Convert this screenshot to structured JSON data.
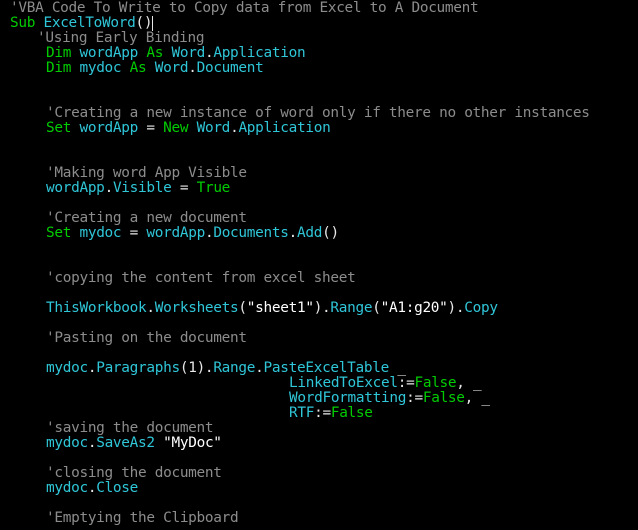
{
  "lines": [
    {
      "indent": 0,
      "tokens": [
        {
          "t": "c",
          "v": "'VBA Code To Write to Copy data from Excel to A Document"
        }
      ]
    },
    {
      "indent": 0,
      "tokens": [
        {
          "t": "k",
          "v": "Sub "
        },
        {
          "t": "i",
          "v": "ExcelToWord"
        },
        {
          "t": "o",
          "v": "()"
        },
        {
          "t": "cursor",
          "v": ""
        }
      ]
    },
    {
      "indent": 27,
      "tokens": [
        {
          "t": "c",
          "v": "'Using Early Binding"
        }
      ]
    },
    {
      "indent": 36,
      "tokens": [
        {
          "t": "k",
          "v": "Dim "
        },
        {
          "t": "i",
          "v": "wordApp "
        },
        {
          "t": "k",
          "v": "As "
        },
        {
          "t": "i",
          "v": "Word"
        },
        {
          "t": "o",
          "v": "."
        },
        {
          "t": "i",
          "v": "Application"
        }
      ]
    },
    {
      "indent": 36,
      "tokens": [
        {
          "t": "k",
          "v": "Dim "
        },
        {
          "t": "i",
          "v": "mydoc "
        },
        {
          "t": "k",
          "v": "As "
        },
        {
          "t": "i",
          "v": "Word"
        },
        {
          "t": "o",
          "v": "."
        },
        {
          "t": "i",
          "v": "Document"
        }
      ]
    },
    {
      "indent": 36,
      "tokens": [
        {
          "t": "c",
          "v": "'Creating a new instance of word only if there no other instances"
        }
      ]
    },
    {
      "indent": 36,
      "tokens": [
        {
          "t": "k",
          "v": "Set "
        },
        {
          "t": "i",
          "v": "wordApp "
        },
        {
          "t": "o",
          "v": "= "
        },
        {
          "t": "k",
          "v": "New "
        },
        {
          "t": "i",
          "v": "Word"
        },
        {
          "t": "o",
          "v": "."
        },
        {
          "t": "i",
          "v": "Application"
        }
      ]
    },
    {
      "indent": 36,
      "tokens": [
        {
          "t": "c",
          "v": "'Making word App Visible"
        }
      ]
    },
    {
      "indent": 36,
      "tokens": [
        {
          "t": "i",
          "v": "wordApp"
        },
        {
          "t": "o",
          "v": "."
        },
        {
          "t": "i",
          "v": "Visible "
        },
        {
          "t": "o",
          "v": "= "
        },
        {
          "t": "k",
          "v": "True"
        }
      ]
    },
    {
      "indent": 36,
      "tokens": [
        {
          "t": "c",
          "v": "'Creating a new document"
        }
      ]
    },
    {
      "indent": 36,
      "tokens": [
        {
          "t": "k",
          "v": "Set "
        },
        {
          "t": "i",
          "v": "mydoc "
        },
        {
          "t": "o",
          "v": "= "
        },
        {
          "t": "i",
          "v": "wordApp"
        },
        {
          "t": "o",
          "v": "."
        },
        {
          "t": "i",
          "v": "Documents"
        },
        {
          "t": "o",
          "v": "."
        },
        {
          "t": "i",
          "v": "Add"
        },
        {
          "t": "o",
          "v": "()"
        }
      ]
    },
    {
      "indent": 36,
      "tokens": [
        {
          "t": "c",
          "v": "'copying the content from excel sheet"
        }
      ]
    },
    {
      "indent": 36,
      "tokens": [
        {
          "t": "i",
          "v": "ThisWorkbook"
        },
        {
          "t": "o",
          "v": "."
        },
        {
          "t": "i",
          "v": "Worksheets"
        },
        {
          "t": "o",
          "v": "("
        },
        {
          "t": "s",
          "v": "\"sheet1\""
        },
        {
          "t": "o",
          "v": ")."
        },
        {
          "t": "i",
          "v": "Range"
        },
        {
          "t": "o",
          "v": "("
        },
        {
          "t": "s",
          "v": "\"A1:g20\""
        },
        {
          "t": "o",
          "v": ")."
        },
        {
          "t": "i",
          "v": "Copy"
        }
      ]
    },
    {
      "indent": 36,
      "tokens": [
        {
          "t": "c",
          "v": "'Pasting on the document"
        }
      ]
    },
    {
      "indent": 36,
      "tokens": [
        {
          "t": "i",
          "v": "mydoc"
        },
        {
          "t": "o",
          "v": "."
        },
        {
          "t": "i",
          "v": "Paragraphs"
        },
        {
          "t": "o",
          "v": "(1)."
        },
        {
          "t": "i",
          "v": "Range"
        },
        {
          "t": "o",
          "v": "."
        },
        {
          "t": "i",
          "v": "PasteExcelTable "
        },
        {
          "t": "o",
          "v": "_"
        }
      ]
    },
    {
      "indent": 279,
      "tokens": [
        {
          "t": "i",
          "v": "LinkedToExcel"
        },
        {
          "t": "o",
          "v": ":="
        },
        {
          "t": "k",
          "v": "False"
        },
        {
          "t": "o",
          "v": ", _"
        }
      ]
    },
    {
      "indent": 279,
      "tokens": [
        {
          "t": "i",
          "v": "WordFormatting"
        },
        {
          "t": "o",
          "v": ":="
        },
        {
          "t": "k",
          "v": "False"
        },
        {
          "t": "o",
          "v": ", _"
        }
      ]
    },
    {
      "indent": 279,
      "tokens": [
        {
          "t": "i",
          "v": "RTF"
        },
        {
          "t": "o",
          "v": ":="
        },
        {
          "t": "k",
          "v": "False"
        }
      ]
    },
    {
      "indent": 36,
      "tokens": [
        {
          "t": "c",
          "v": "'saving the document"
        }
      ]
    },
    {
      "indent": 36,
      "tokens": [
        {
          "t": "i",
          "v": "mydoc"
        },
        {
          "t": "o",
          "v": "."
        },
        {
          "t": "i",
          "v": "SaveAs2 "
        },
        {
          "t": "s",
          "v": "\"MyDoc\""
        }
      ]
    },
    {
      "indent": 36,
      "tokens": [
        {
          "t": "c",
          "v": "'closing the document"
        }
      ]
    },
    {
      "indent": 36,
      "tokens": [
        {
          "t": "i",
          "v": "mydoc"
        },
        {
          "t": "o",
          "v": "."
        },
        {
          "t": "i",
          "v": "Close"
        }
      ]
    },
    {
      "indent": 36,
      "tokens": [
        {
          "t": "c",
          "v": "'Emptying the Clipboard"
        }
      ]
    }
  ]
}
